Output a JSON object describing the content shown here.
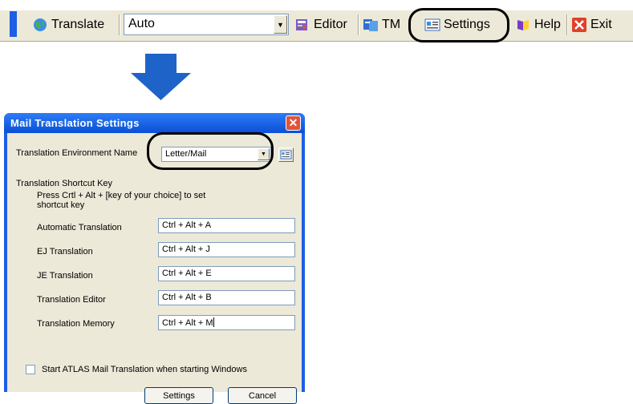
{
  "toolbar": {
    "translate_label": "Translate",
    "mode_value": "Auto",
    "editor_label": "Editor",
    "tm_label": "TM",
    "settings_label": "Settings",
    "help_label": "Help",
    "exit_label": "Exit"
  },
  "dialog": {
    "title": "Mail Translation Settings",
    "env_label": "Translation Environment Name",
    "env_value": "Letter/Mail",
    "shortcut_heading": "Translation Shortcut Key",
    "shortcut_hint_line1": "Press Crtl + Alt + [key of your choice] to set",
    "shortcut_hint_line2": "shortcut key",
    "shortcuts": [
      {
        "label": "Automatic Translation",
        "value": "Ctrl + Alt + A"
      },
      {
        "label": "EJ Translation",
        "value": "Ctrl + Alt + J"
      },
      {
        "label": "JE Translation",
        "value": "Ctrl + Alt + E"
      },
      {
        "label": "Translation Editor",
        "value": "Ctrl + Alt + B"
      },
      {
        "label": "Translation Memory",
        "value": "Ctrl + Alt + M"
      }
    ],
    "startup_checkbox_label": "Start ATLAS Mail Translation when starting Windows",
    "settings_button": "Settings",
    "cancel_button": "Cancel"
  },
  "colors": {
    "titlebar": "#0a4fd8",
    "dialog_bg": "#ece9d8",
    "arrow": "#1e63c8",
    "toolbar_grip": "#1c5ee6"
  }
}
